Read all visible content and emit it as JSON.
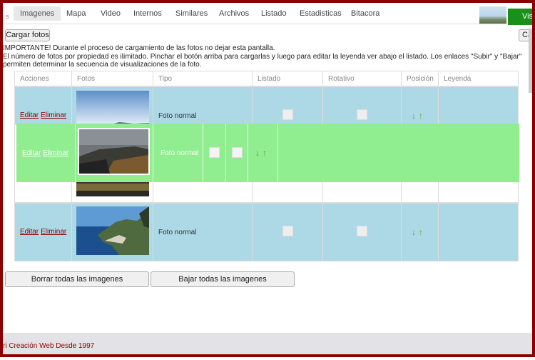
{
  "tabs": {
    "left_fragment": "s",
    "items": [
      "Imagenes",
      "Mapa",
      "Video",
      "Internos",
      "Similares",
      "Archivos",
      "Listado",
      "Estadisticas",
      "Bitacora"
    ],
    "visit_label": "Visi"
  },
  "toolbar": {
    "upload_label": "Cargar fotos",
    "upload_right_label": "Car"
  },
  "notes": {
    "line1": "IMPORTANTE! Durante el proceso de cargamiento de las fotos no dejar esta pantalla.",
    "line2": "El número de fotos por propiedad es ilimitado. Pinchar el botón arriba para cargarlas y luego para editar la leyenda ver abajo el listado. Los enlaces \"Subir\" y \"Bajar\"",
    "line3": "permiten determinar la secuencia de visualizaciones de la foto."
  },
  "table": {
    "headers": [
      "Acciones",
      "Fotos",
      "Tipo",
      "Listado",
      "Rotativo",
      "Posición",
      "Leyenda"
    ],
    "edit_label": "Editar",
    "delete_label": "Eliminar",
    "rows": [
      {
        "tipo": "Foto normal",
        "arrows": "↓↑"
      },
      {
        "tipo": "Foto normal",
        "arrows": "↓↑"
      },
      {
        "tipo": "",
        "arrows": ""
      },
      {
        "tipo": "Foto normal",
        "arrows": "↓↑"
      }
    ]
  },
  "actions": {
    "delete_all_label": "Borrar todas las imagenes",
    "download_all_label": "Bajar todas las imagenes"
  },
  "footer": {
    "text": "ri Creación Web Desde 1997"
  },
  "colors": {
    "frame": "#8b0000",
    "row_blue": "#add8e6",
    "drag_green": "#90ee90",
    "visit_green": "#1a8f1a",
    "arrow_green": "#6aa82a"
  }
}
